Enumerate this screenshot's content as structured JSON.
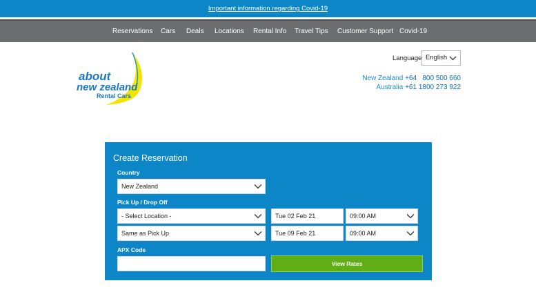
{
  "banner": {
    "text": "Important information regarding Covid-19"
  },
  "nav": {
    "items": [
      "Reservations",
      "Cars",
      "Deals",
      "Locations",
      "Rental Info",
      "Travel Tips",
      "Customer Support",
      "Covid-19"
    ]
  },
  "logo": {
    "line1": "about",
    "line2": "new zealand",
    "line3": "Rental Cars",
    "blue": "#1878c8",
    "yellow": "#f4e500"
  },
  "header": {
    "language_label": "Language",
    "language_value": "English",
    "phones": [
      {
        "country": "New Zealand",
        "code": "+64",
        "number": "800 500 660"
      },
      {
        "country": "Australia",
        "code": "+61",
        "number": "1800 273 922"
      }
    ]
  },
  "reservation": {
    "title": "Create Reservation",
    "country_label": "Country",
    "country_value": "New Zealand",
    "pickup_label": "Pick Up / Drop Off",
    "pickup_location": "- Select Location -",
    "pickup_date": "Tue 02 Feb 21",
    "pickup_time": "09:00 AM",
    "dropoff_location": "Same as Pick Up",
    "dropoff_date": "Tue 09 Feb 21",
    "dropoff_time": "09:00 AM",
    "apx_label": "APX Code",
    "apx_value": "",
    "submit_label": "View Rates"
  },
  "colors": {
    "banner": "#0d86c8",
    "nav": "#6d6e70",
    "panel": "#0d86c8",
    "button": "#5fae15",
    "phone": "#1a8fd1"
  }
}
